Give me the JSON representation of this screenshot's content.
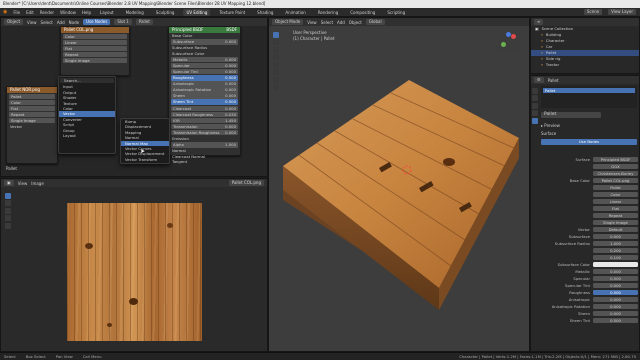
{
  "titlebar": "Blender* [C:\\Users\\dent\\Documents\\Online Courses\\Blender 2.8 UV Mapping\\Blender Scene Files\\Blender 28 UV Mapping 12.blend]",
  "menubar": {
    "menus": [
      "File",
      "Edit",
      "Render",
      "Window",
      "Help"
    ],
    "workspaces": [
      "Layout",
      "Modeling",
      "Sculpting",
      "UV Editing",
      "Texture Paint",
      "Shading",
      "Animation",
      "Rendering",
      "Compositing",
      "Scripting"
    ],
    "active_workspace": "UV Editing",
    "scene": "Scene",
    "view_layer": "View Layer"
  },
  "node_editor": {
    "header": [
      "Object",
      "View",
      "Select",
      "Add",
      "Node",
      "Use Nodes",
      "Slot 1",
      "Pallet"
    ],
    "image_node": {
      "title": "Pallet COL.png",
      "fields": [
        "Color",
        "Linear",
        "Flat",
        "Repeat",
        "Single Image"
      ]
    },
    "image_node2": {
      "title": "Pallet NOR.png",
      "fields": [
        "Pallet",
        "Color",
        "Flat",
        "Repeat",
        "Single Image",
        "Vector"
      ]
    },
    "add_menu": {
      "search": "Search...",
      "items": [
        "Input",
        "Output",
        "Shader",
        "Texture",
        "Color",
        "Vector",
        "Converter",
        "Script",
        "Group",
        "Layout"
      ],
      "highlighted": "Vector"
    },
    "vector_submenu": {
      "items": [
        "Bump",
        "Displacement",
        "Mapping",
        "Normal",
        "Normal Map",
        "Vector Curves",
        "Vector Displacement",
        "Vector Transform"
      ],
      "highlighted": "Normal Map"
    },
    "bsdf_node": {
      "title": "Principled BSDF",
      "out": "BSDF",
      "rows": [
        {
          "label": "Base Color",
          "value": ""
        },
        {
          "label": "Subsurface",
          "value": "0.000"
        },
        {
          "label": "Subsurface Radius",
          "value": ""
        },
        {
          "label": "Subsurface Color",
          "value": ""
        },
        {
          "label": "Metallic",
          "value": "0.000"
        },
        {
          "label": "Specular",
          "value": "0.500"
        },
        {
          "label": "Specular Tint",
          "value": "0.000"
        },
        {
          "label": "Roughness",
          "value": "0.500"
        },
        {
          "label": "Anisotropic",
          "value": "0.000"
        },
        {
          "label": "Anisotropic Rotation",
          "value": "0.000"
        },
        {
          "label": "Sheen",
          "value": "0.000"
        },
        {
          "label": "Sheen Tint",
          "value": "0.500"
        },
        {
          "label": "Clearcoat",
          "value": "0.000"
        },
        {
          "label": "Clearcoat Roughness",
          "value": "0.030"
        },
        {
          "label": "IOR",
          "value": "1.450"
        },
        {
          "label": "Transmission",
          "value": "0.000"
        },
        {
          "label": "Transmission Roughness",
          "value": "0.000"
        },
        {
          "label": "Emission",
          "value": ""
        },
        {
          "label": "Alpha",
          "value": "1.000"
        },
        {
          "label": "Normal",
          "value": ""
        },
        {
          "label": "Clearcoat Normal",
          "value": ""
        },
        {
          "label": "Tangent",
          "value": ""
        }
      ]
    },
    "bottom_label": "Pallet"
  },
  "image_editor": {
    "header": [
      "View",
      "Image"
    ],
    "image_name": "Pallet COL.png"
  },
  "viewport": {
    "header": [
      "Object Mode",
      "View",
      "Select",
      "Add",
      "Object",
      "Global"
    ],
    "overlay_title": "User Perspective",
    "overlay_sub": "(1) Character | Pallet"
  },
  "outliner": {
    "title": "Scene Collection",
    "rows": [
      "Scene Collection",
      "Building",
      "Character",
      "Car",
      "Pallet",
      "Side rig",
      "Tractor"
    ]
  },
  "properties": {
    "object": "Pallet",
    "material_slot": "Pallet",
    "material": "Pallet",
    "sections": [
      "Preview",
      "Surface"
    ],
    "use_nodes": "Use Nodes",
    "rows": [
      {
        "label": "Surface",
        "value": "Principled BSDF"
      },
      {
        "label": "",
        "value": "GGX"
      },
      {
        "label": "",
        "value": "Christensen-Burley"
      },
      {
        "label": "Base Color",
        "value": "Pallet COL.png"
      },
      {
        "label": "",
        "value": "Pallet"
      },
      {
        "label": "",
        "value": "Color"
      },
      {
        "label": "",
        "value": "Linear"
      },
      {
        "label": "",
        "value": "Flat"
      },
      {
        "label": "",
        "value": "Repeat"
      },
      {
        "label": "",
        "value": "Single Image"
      },
      {
        "label": "Vector",
        "value": "Default"
      },
      {
        "label": "Subsurface",
        "value": "0.000"
      },
      {
        "label": "Subsurface Radius",
        "value": "1.000"
      },
      {
        "label": "",
        "value": "0.200"
      },
      {
        "label": "",
        "value": "0.100"
      },
      {
        "label": "Subsurface Color",
        "value": ""
      },
      {
        "label": "Metallic",
        "value": "0.000"
      },
      {
        "label": "Specular",
        "value": "0.500"
      },
      {
        "label": "Specular Tint",
        "value": "0.000"
      },
      {
        "label": "Roughness",
        "value": "0.500"
      },
      {
        "label": "Anisotropic",
        "value": "0.000"
      },
      {
        "label": "Anisotropic Rotation",
        "value": "0.000"
      },
      {
        "label": "Sheen",
        "value": "0.000"
      },
      {
        "label": "Sheen Tint",
        "value": "0.500"
      }
    ]
  },
  "statusbar": {
    "items": [
      "Select",
      "Box Select",
      "Pan View",
      "Call Menu"
    ],
    "right": "Character | Pallet | Verts:1.2M | Faces:1.1M | Tris:2.2M | Objects:0/1 | Mem: 271 MiB | 2.80.75"
  },
  "colors": {
    "accent": "#4772b3",
    "wood": "#b8753a"
  }
}
